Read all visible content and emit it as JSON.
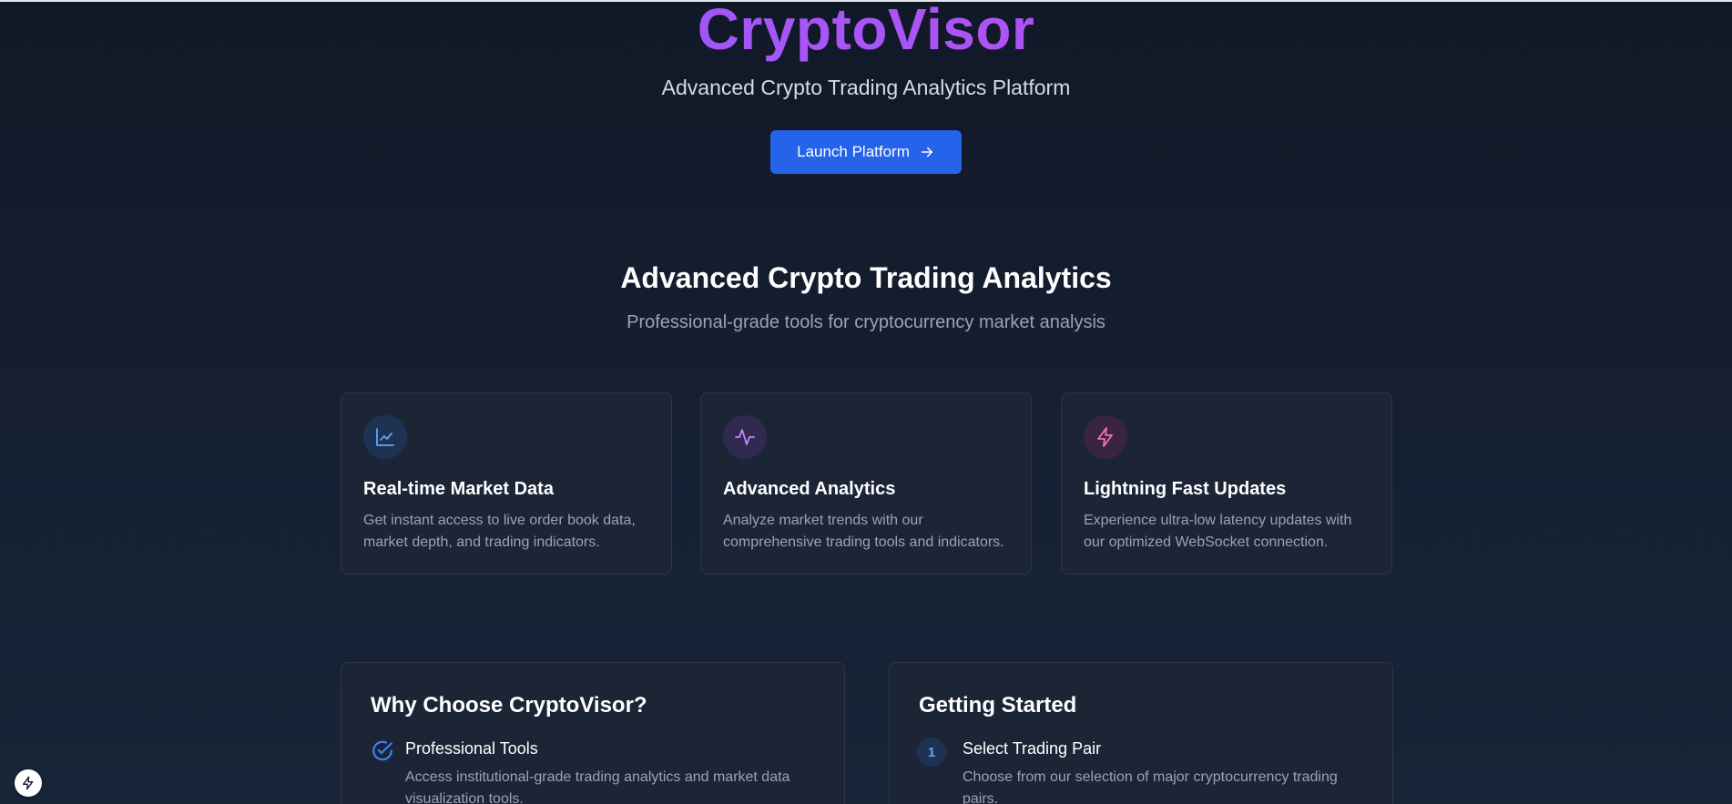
{
  "hero": {
    "brand": "CryptoVisor",
    "tagline": "Advanced Crypto Trading Analytics Platform",
    "launch_label": "Launch Platform"
  },
  "features_section": {
    "title": "Advanced Crypto Trading Analytics",
    "subtitle": "Professional-grade tools for cryptocurrency market analysis",
    "cards": [
      {
        "icon": "line-chart-icon",
        "title": "Real-time Market Data",
        "description": "Get instant access to live order book data, market depth, and trading indicators."
      },
      {
        "icon": "activity-icon",
        "title": "Advanced Analytics",
        "description": "Analyze market trends with our comprehensive trading tools and indicators."
      },
      {
        "icon": "lightning-icon",
        "title": "Lightning Fast Updates",
        "description": "Experience ultra-low latency updates with our optimized WebSocket connection."
      }
    ]
  },
  "why": {
    "title": "Why Choose CryptoVisor?",
    "items": [
      {
        "icon": "check-circle-icon",
        "title": "Professional Tools",
        "description": "Access institutional-grade trading analytics and market data visualization tools."
      }
    ]
  },
  "getting_started": {
    "title": "Getting Started",
    "steps": [
      {
        "number": "1",
        "title": "Select Trading Pair",
        "description": "Choose from our selection of major cryptocurrency trading pairs."
      }
    ]
  },
  "colors": {
    "accent": "#2563eb",
    "brand_gradient_start": "#8b5cf6",
    "brand_gradient_end": "#c04bf0",
    "card_bg": "#1c2536"
  }
}
